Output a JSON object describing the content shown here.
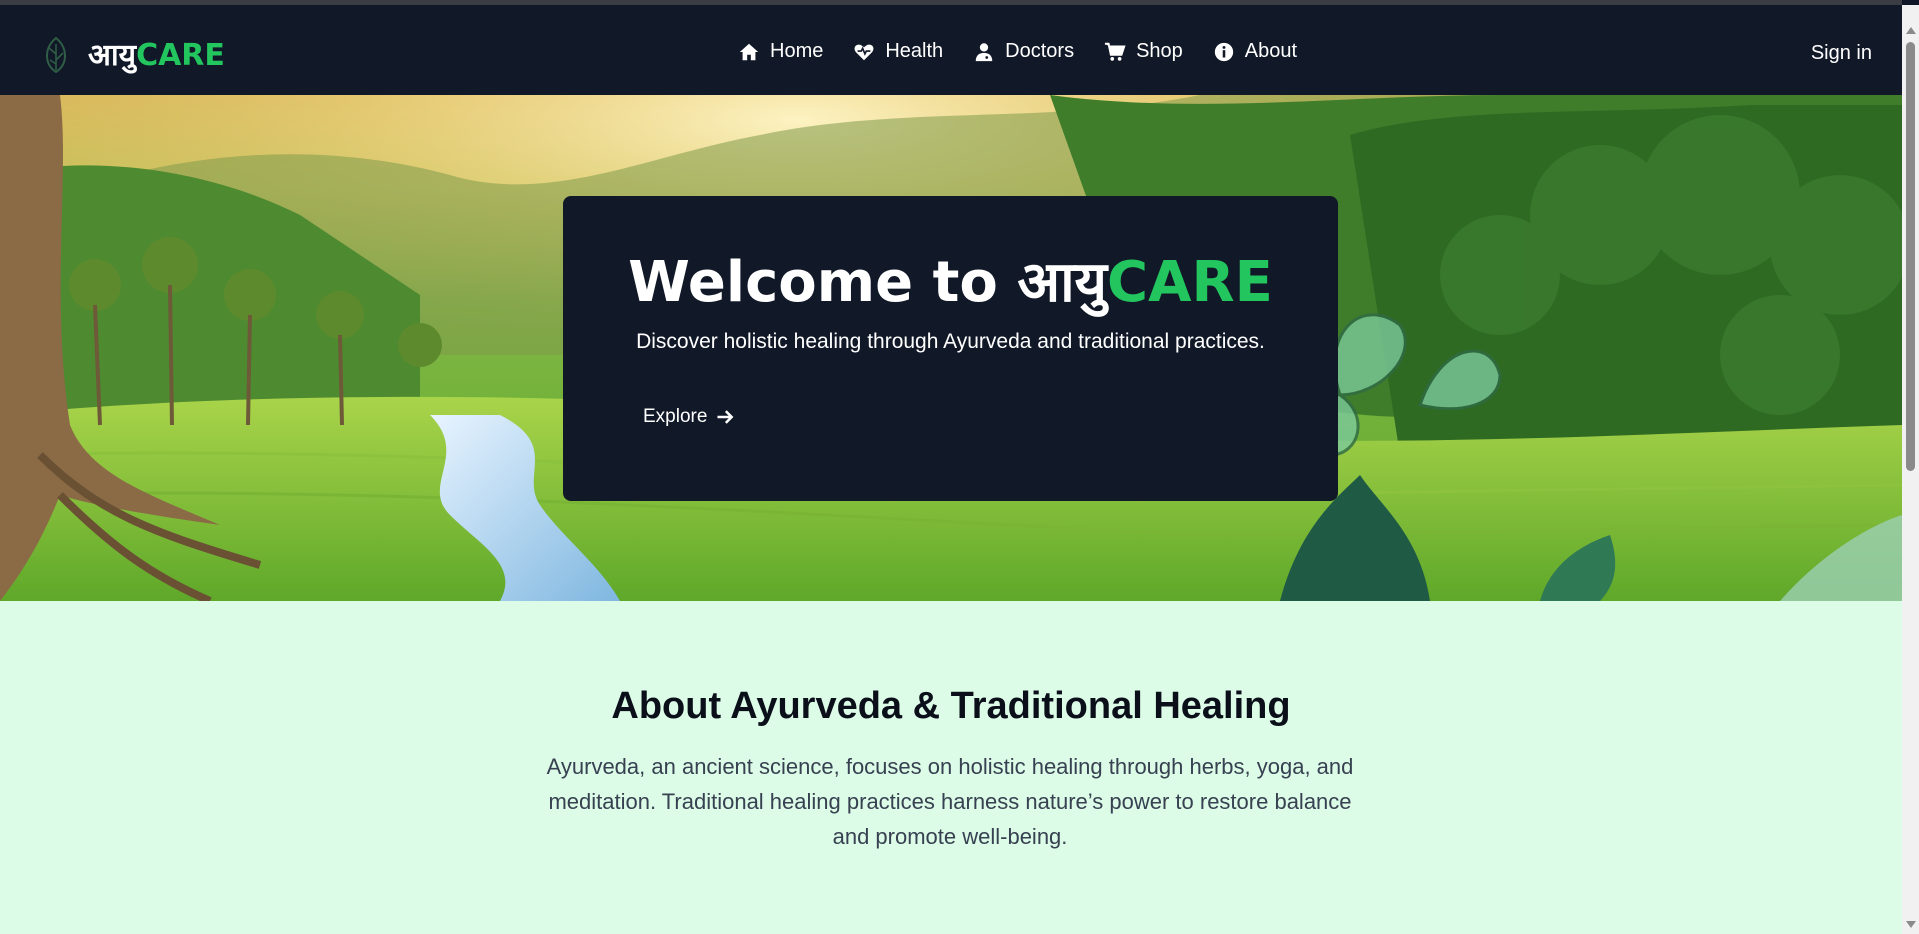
{
  "brand": {
    "name_devanagari": "आयु",
    "name_latin": "CARE",
    "accent_color": "#22c55e"
  },
  "nav": {
    "items": [
      {
        "label": "Home",
        "icon": "home-icon"
      },
      {
        "label": "Health",
        "icon": "heart-pulse-icon"
      },
      {
        "label": "Doctors",
        "icon": "doctor-icon"
      },
      {
        "label": "Shop",
        "icon": "cart-icon"
      },
      {
        "label": "About",
        "icon": "info-icon"
      }
    ],
    "signin_label": "Sign in"
  },
  "hero": {
    "title_prefix": "Welcome to ",
    "title_devanagari": "आयु",
    "title_latin": "CARE",
    "subtitle": "Discover holistic healing through Ayurveda and traditional practices.",
    "explore_label": "Explore",
    "card_color": "#111827"
  },
  "about": {
    "title": "About Ayurveda & Traditional Healing",
    "text": "Ayurveda, an ancient science, focuses on holistic healing through herbs, yoga, and meditation. Traditional healing practices harness nature’s power to restore balance and promote well-being.",
    "background": "#dcfce7"
  }
}
